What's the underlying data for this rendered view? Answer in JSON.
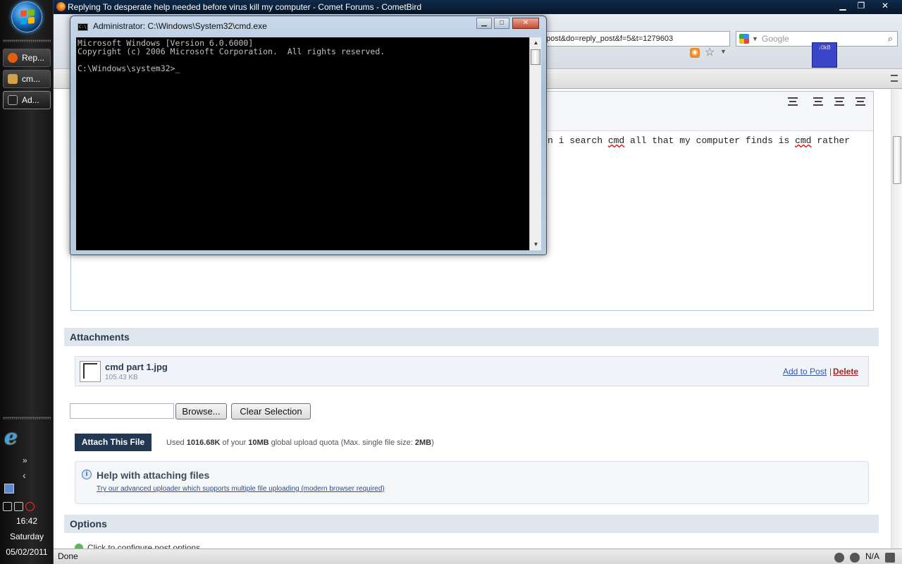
{
  "taskbar": {
    "items": [
      {
        "label": "Rep...",
        "color": "#e06010"
      },
      {
        "label": "cm...",
        "color": "#d2a24a"
      },
      {
        "label": "Ad...",
        "color": "#222222"
      }
    ],
    "time": "16:42",
    "day": "Saturday",
    "date": "05/02/2011"
  },
  "browser": {
    "title": "Replying To desperate help needed before virus kill my computer - Comet Forums - CometBird",
    "url": "post&do=reply_post&f=5&t=1279603",
    "search_placeholder": "Google",
    "net_meter": "↓0kB",
    "status": "Done",
    "status_right": "N/A"
  },
  "editor": {
    "visible_text_before": "n i search ",
    "word1": "cmd",
    "visible_text_mid": " all that my computer finds is ",
    "word2": "cmd",
    "visible_text_after": " rather"
  },
  "attachments": {
    "heading": "Attachments",
    "file_name": "cmd part 1.jpg",
    "file_size": "105.43 KB",
    "add_to_post": "Add to Post",
    "separator": "|",
    "delete": "Delete",
    "browse_label": "Browse...",
    "clear_label": "Clear Selection",
    "attach_label": "Attach This File",
    "quota_used_prefix": "Used ",
    "quota_used": "1016.68K",
    "quota_mid": " of your ",
    "quota_total": "10MB",
    "quota_mid2": " global upload quota (Max. single file size: ",
    "quota_max": "2MB",
    "quota_suffix": ")",
    "help_title": "Help with attaching files",
    "help_link": "Try our advanced uploader which supports multiple file uploading (modern browser required)"
  },
  "options": {
    "heading": "Options",
    "link": "Click to configure post options"
  },
  "cmd": {
    "title": "Administrator: C:\\Windows\\System32\\cmd.exe",
    "line1": "Microsoft Windows [Version 6.0.6000]",
    "line2": "Copyright (c) 2006 Microsoft Corporation.  All rights reserved.",
    "prompt": "C:\\Windows\\system32>_"
  },
  "colors": {
    "accent": "#223752",
    "section_header_bg": "#dfe6ee",
    "delete_red": "#b02020"
  }
}
